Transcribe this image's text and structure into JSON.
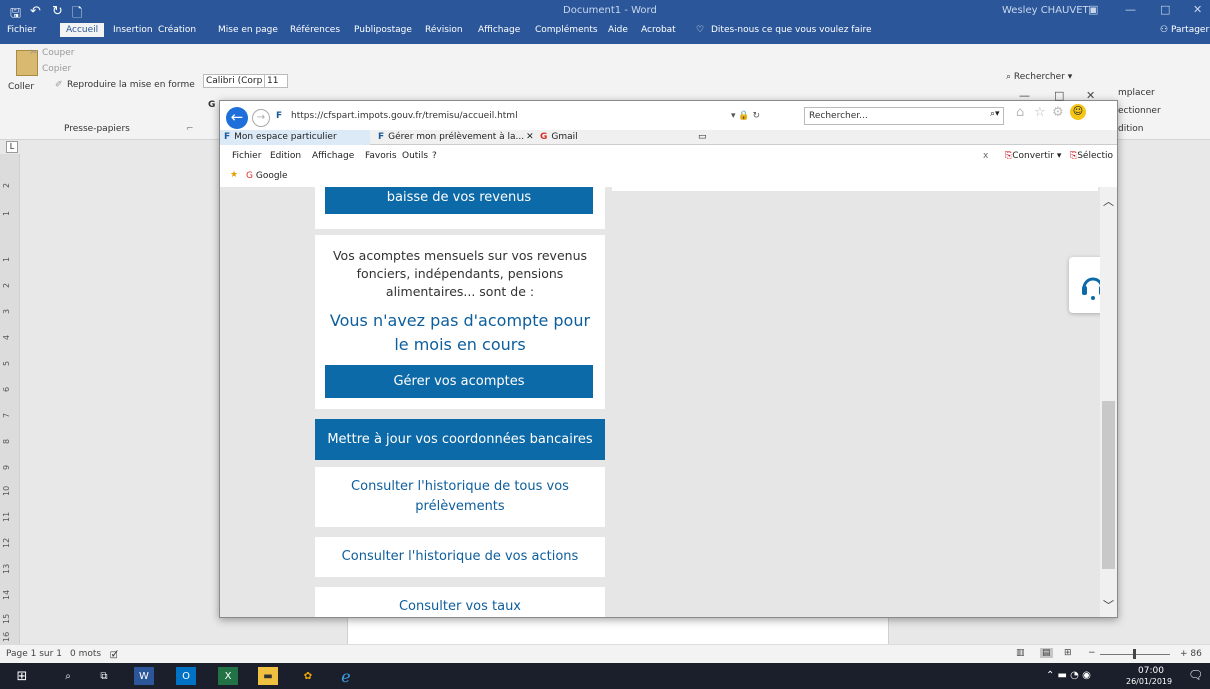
{
  "word": {
    "title": "Document1 - Word",
    "user": "Wesley CHAUVET",
    "menu_tabs": [
      "Fichier",
      "Accueil",
      "Insertion",
      "Création",
      "Mise en page",
      "Références",
      "Publipostage",
      "Révision",
      "Affichage",
      "Compléments",
      "Aide",
      "Acrobat"
    ],
    "tell_me": "Dites-nous ce que vous voulez faire",
    "share": "Partager",
    "ribbon": {
      "cut": "Couper",
      "copy": "Copier",
      "paste": "Coller",
      "format_painter": "Reproduire la mise en forme",
      "group_clipboard": "Presse-papiers",
      "font_name": "Calibri (Corp",
      "font_size": "11",
      "find": "Rechercher",
      "replace": "mplacer",
      "select": "ectionner",
      "editing": "dition"
    },
    "status": {
      "page": "Page 1 sur 1",
      "words": "0 mots",
      "zoom": "+ 86"
    },
    "ruler_numbers": [
      "2",
      "1",
      "1",
      "2",
      "3",
      "4",
      "5",
      "6",
      "7",
      "8",
      "9",
      "10",
      "11",
      "12",
      "13",
      "14",
      "15",
      "16"
    ]
  },
  "ie": {
    "url": "https://cfspart.impots.gouv.fr/tremisu/accueil.html",
    "search_placeholder": "Rechercher...",
    "tabs": [
      "Mon espace particulier",
      "Gérer mon prélèvement à la...",
      "Gmail"
    ],
    "menu": [
      "Fichier",
      "Edition",
      "Affichage",
      "Favoris",
      "Outils",
      "?"
    ],
    "toolbar_right": [
      "Convertir",
      "Sélectio"
    ],
    "favorites": [
      "Google"
    ]
  },
  "page": {
    "income_drop_button": "baisse de vos revenus",
    "acompte_info": "Vos acomptes mensuels sur vos revenus fonciers, indépendants, pensions alimentaires... sont de :",
    "acompte_value": "Vous n'avez pas d'acompte pour le mois en cours",
    "manage_acomptes": "Gérer vos acomptes",
    "update_bank": "Mettre à jour vos coordonnées bancaires",
    "history_prelevements": "Consulter l'historique de tous vos prélèvements",
    "history_actions": "Consulter l'historique de vos actions",
    "view_rates": "Consulter vos taux"
  },
  "taskbar": {
    "time": "07:00",
    "date": "26/01/2019"
  },
  "colors": {
    "word_blue": "#2b579a",
    "dgfip_blue": "#0d6aa8",
    "link_blue": "#0d5e9c"
  }
}
